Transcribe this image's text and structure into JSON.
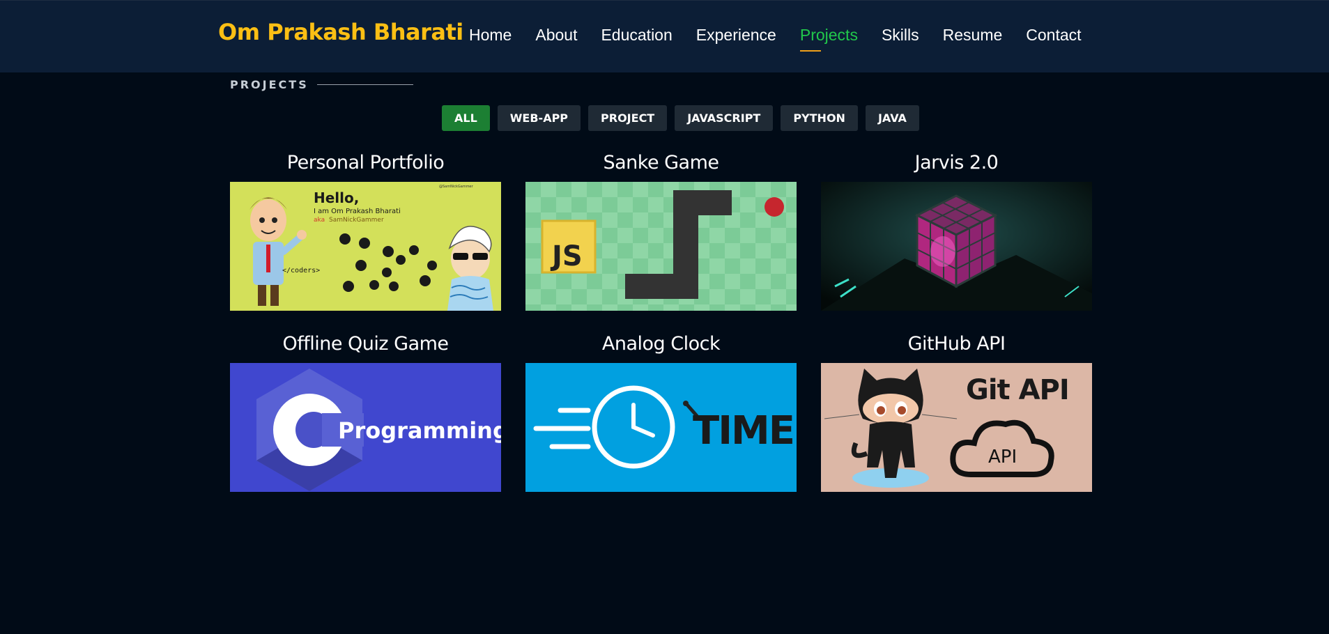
{
  "brand": "Om Prakash Bharati",
  "nav": [
    "Home",
    "About",
    "Education",
    "Experience",
    "Projects",
    "Skills",
    "Resume",
    "Contact"
  ],
  "nav_active": "Projects",
  "section_label": "PROJECTS",
  "filters": [
    "ALL",
    "WEB-APP",
    "PROJECT",
    "JAVASCRIPT",
    "PYTHON",
    "JAVA"
  ],
  "filter_active": "ALL",
  "projects": [
    {
      "title": "Personal Portfolio",
      "thumb": {
        "hello": "Hello,",
        "line1": "I am Om Prakash Bharati",
        "line2_prefix": "aka",
        "line2_name": "SamNickGammer",
        "tag": "</coders>",
        "handle": "@SamNickGammer"
      }
    },
    {
      "title": "Sanke Game",
      "thumb": {
        "badge": "JS"
      }
    },
    {
      "title": "Jarvis 2.0",
      "thumb": {}
    },
    {
      "title": "Offline Quiz Game",
      "thumb": {
        "letter": "C",
        "word": "Programming"
      }
    },
    {
      "title": "Analog Clock",
      "thumb": {
        "word": "TIME"
      }
    },
    {
      "title": "GitHub API",
      "thumb": {
        "heading": "Git API",
        "cloud": "API"
      }
    }
  ],
  "colors": {
    "nav_bg": "#0c1e36",
    "page_bg": "#010b17",
    "brand": "#fbbf14",
    "active_link": "#21c84b",
    "active_filter": "#1c7f33",
    "filter_bg": "#1f2a35"
  }
}
